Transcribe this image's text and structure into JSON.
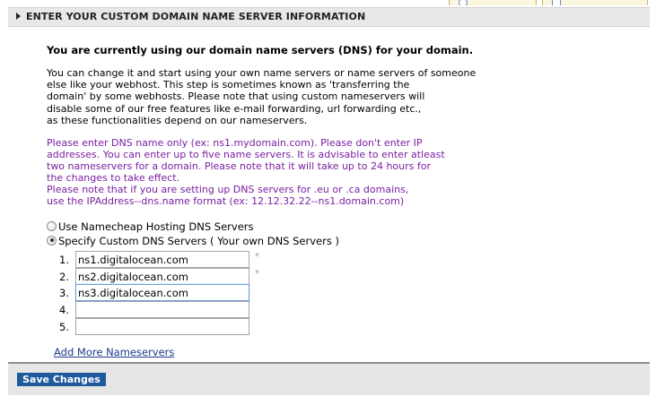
{
  "section": {
    "title": "ENTER YOUR CUSTOM DOMAIN NAME SERVER INFORMATION"
  },
  "content": {
    "heading": "You are currently using our domain name servers (DNS) for your domain.",
    "intro_lines": [
      "You can change it and start using your own name servers or name servers of someone",
      "else like your webhost. This step is sometimes known as 'transferring the",
      "domain' by some webhosts. Please note that using custom nameservers will",
      "disable some of our free features like e-mail forwarding, url forwarding etc.,",
      "as these functionalities depend on our nameservers."
    ],
    "note_lines": [
      "Please enter DNS name only (ex: ns1.mydomain.com). Please don't enter IP",
      "addresses. You can enter up to five name servers. It is advisable to enter atleast",
      "two nameservers for a domain. Please note that it will take up to 24 hours for",
      "the changes to take effect.",
      "Please note that if you are setting up DNS servers for .eu or .ca domains,",
      "use the IPAddress--dns.name format (ex: 12.12.32.22--ns1.domain.com)"
    ]
  },
  "options": {
    "namecheap": {
      "label": "Use Namecheap Hosting DNS Servers",
      "checked": false
    },
    "custom": {
      "label": "Specify Custom DNS Servers ( Your own DNS Servers )",
      "checked": true
    }
  },
  "nameservers": [
    {
      "num": "1.",
      "value": "ns1.digitalocean.com",
      "required_mark": "*"
    },
    {
      "num": "2.",
      "value": "ns2.digitalocean.com",
      "required_mark": "*"
    },
    {
      "num": "3.",
      "value": "ns3.digitalocean.com",
      "required_mark": ""
    },
    {
      "num": "4.",
      "value": "",
      "required_mark": ""
    },
    {
      "num": "5.",
      "value": "",
      "required_mark": ""
    }
  ],
  "links": {
    "add_more": "Add More Nameservers"
  },
  "footer": {
    "save_label": "Save Changes"
  }
}
